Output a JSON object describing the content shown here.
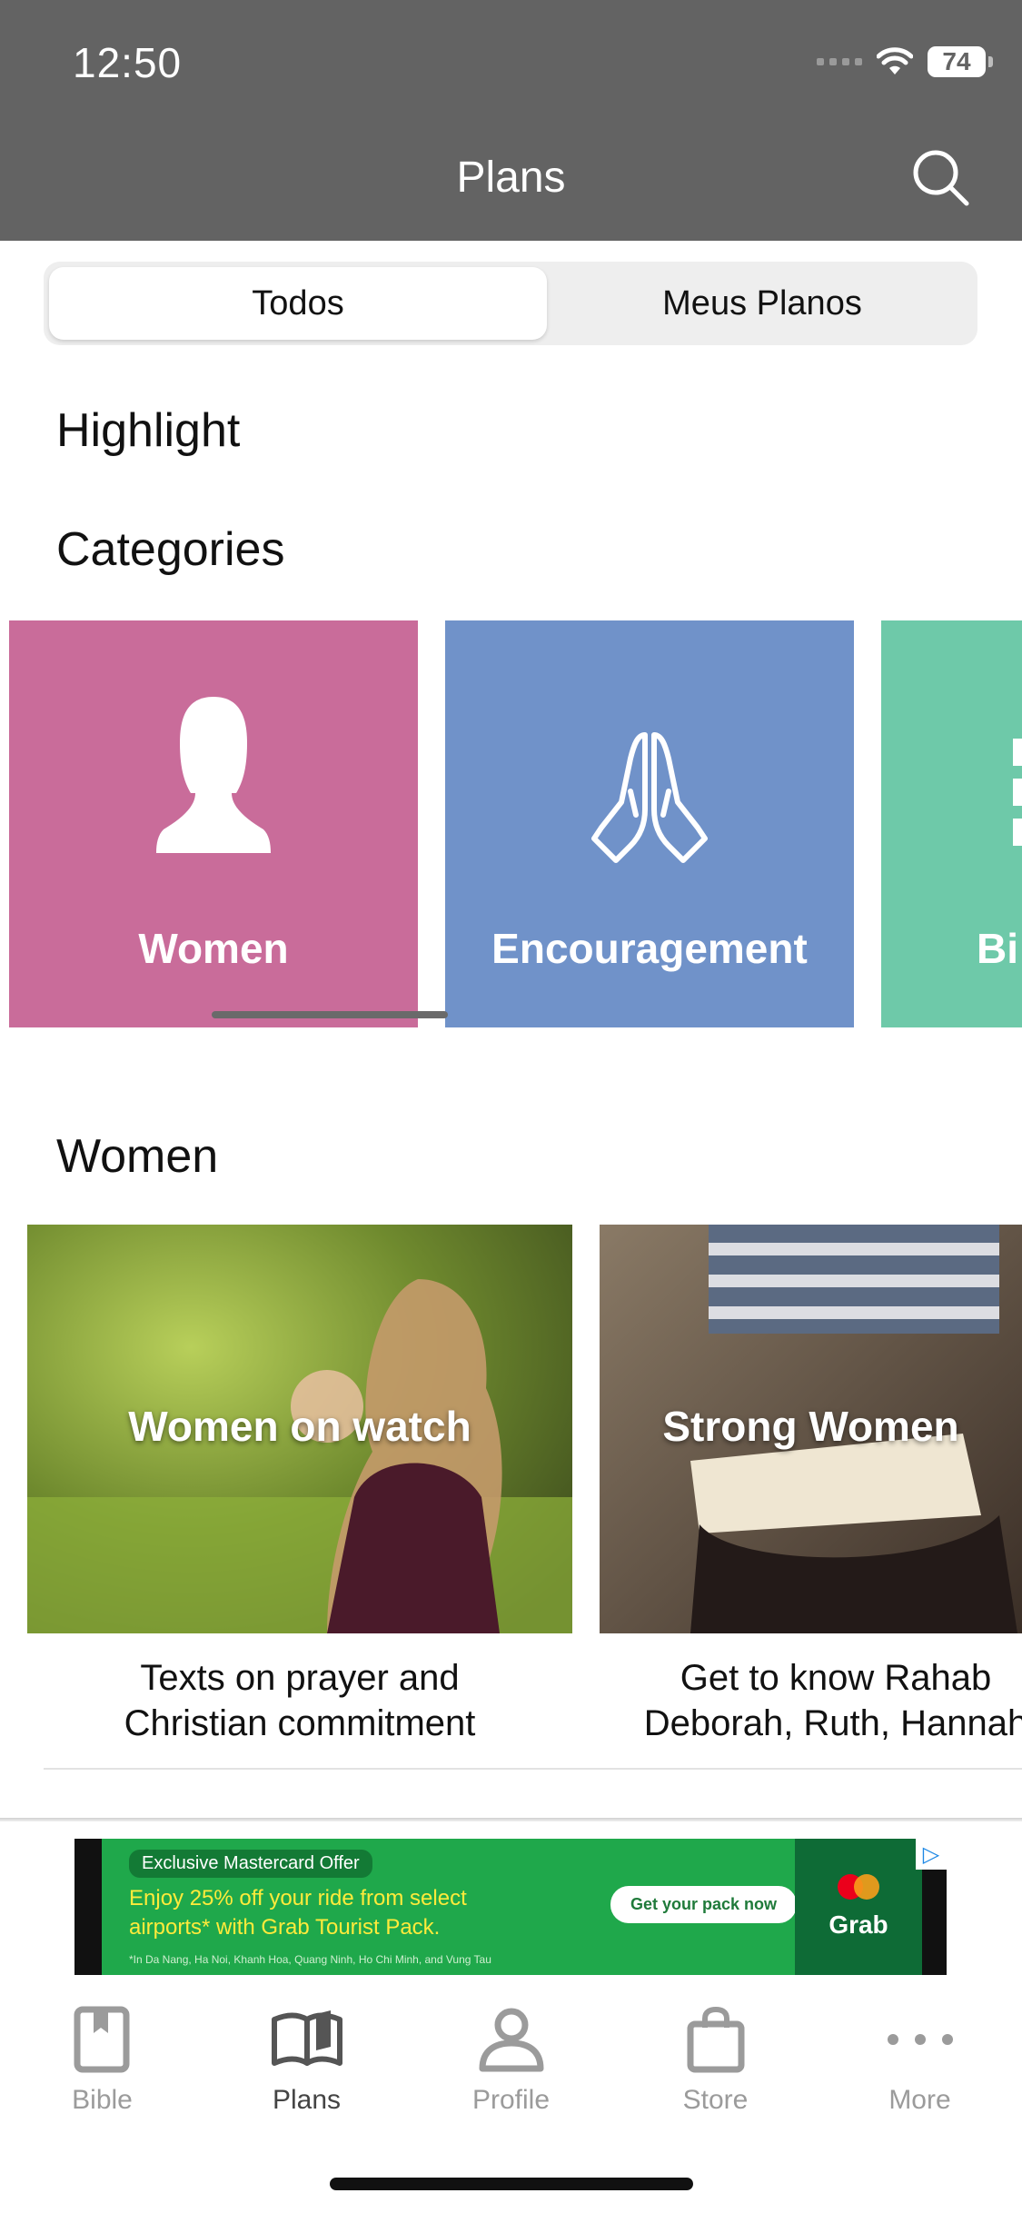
{
  "status_bar": {
    "time": "12:50",
    "battery": "74"
  },
  "header": {
    "title": "Plans",
    "search_icon": "search-icon"
  },
  "segmented_control": {
    "all": "Todos",
    "my_plans": "Meus Planos",
    "selected": "Todos"
  },
  "sections": {
    "highlight": "Highlight",
    "categories": "Categories",
    "women": "Women"
  },
  "categories": [
    {
      "label": "Women",
      "color": "#c96c9a",
      "icon": "woman-icon"
    },
    {
      "label": "Encouragement",
      "color": "#7092c9",
      "icon": "praying-hands-icon"
    },
    {
      "label": "Bi",
      "color": "#6ec9a9",
      "icon": "bible-icon"
    }
  ],
  "plans": [
    {
      "title": "Women on watch",
      "description": "Texts on prayer and\nChristian commitment"
    },
    {
      "title": "Strong Women",
      "description": "Get to know Rahab\nDeborah, Ruth, Hannah"
    }
  ],
  "ad": {
    "offer": "Exclusive Mastercard Offer",
    "text": "Enjoy 25% off your ride from select airports* with Grab Tourist Pack.",
    "button": "Get your pack now",
    "fine_print": "*In Da Nang, Ha Noi, Khanh Hoa, Quang Ninh, Ho Chi Minh, and Vung Tau",
    "brand": "Grab"
  },
  "tabs": [
    {
      "label": "Bible",
      "icon": "bible-book-icon"
    },
    {
      "label": "Plans",
      "icon": "open-book-icon",
      "active": true
    },
    {
      "label": "Profile",
      "icon": "person-icon"
    },
    {
      "label": "Store",
      "icon": "shopping-bag-icon"
    },
    {
      "label": "More",
      "icon": "ellipsis-icon"
    }
  ]
}
